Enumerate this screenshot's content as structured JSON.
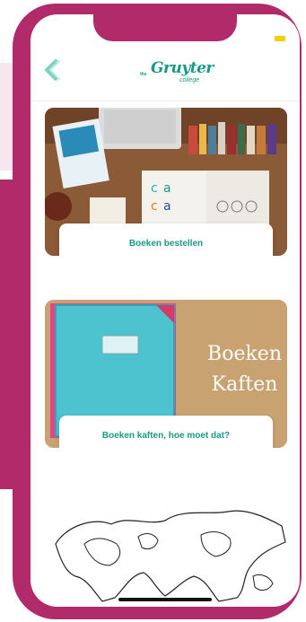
{
  "header": {
    "logo_pre": "the",
    "logo_main": "Gruyter",
    "logo_sub": "college"
  },
  "cards": [
    {
      "label": "Boeken bestellen"
    },
    {
      "label": "Boeken kaften, hoe moet dat?",
      "overlay_line1": "Boeken",
      "overlay_line2": "Kaften"
    }
  ],
  "colors": {
    "accent": "#1a9a86",
    "frame": "#b12a6a",
    "status": "#f4d000"
  }
}
